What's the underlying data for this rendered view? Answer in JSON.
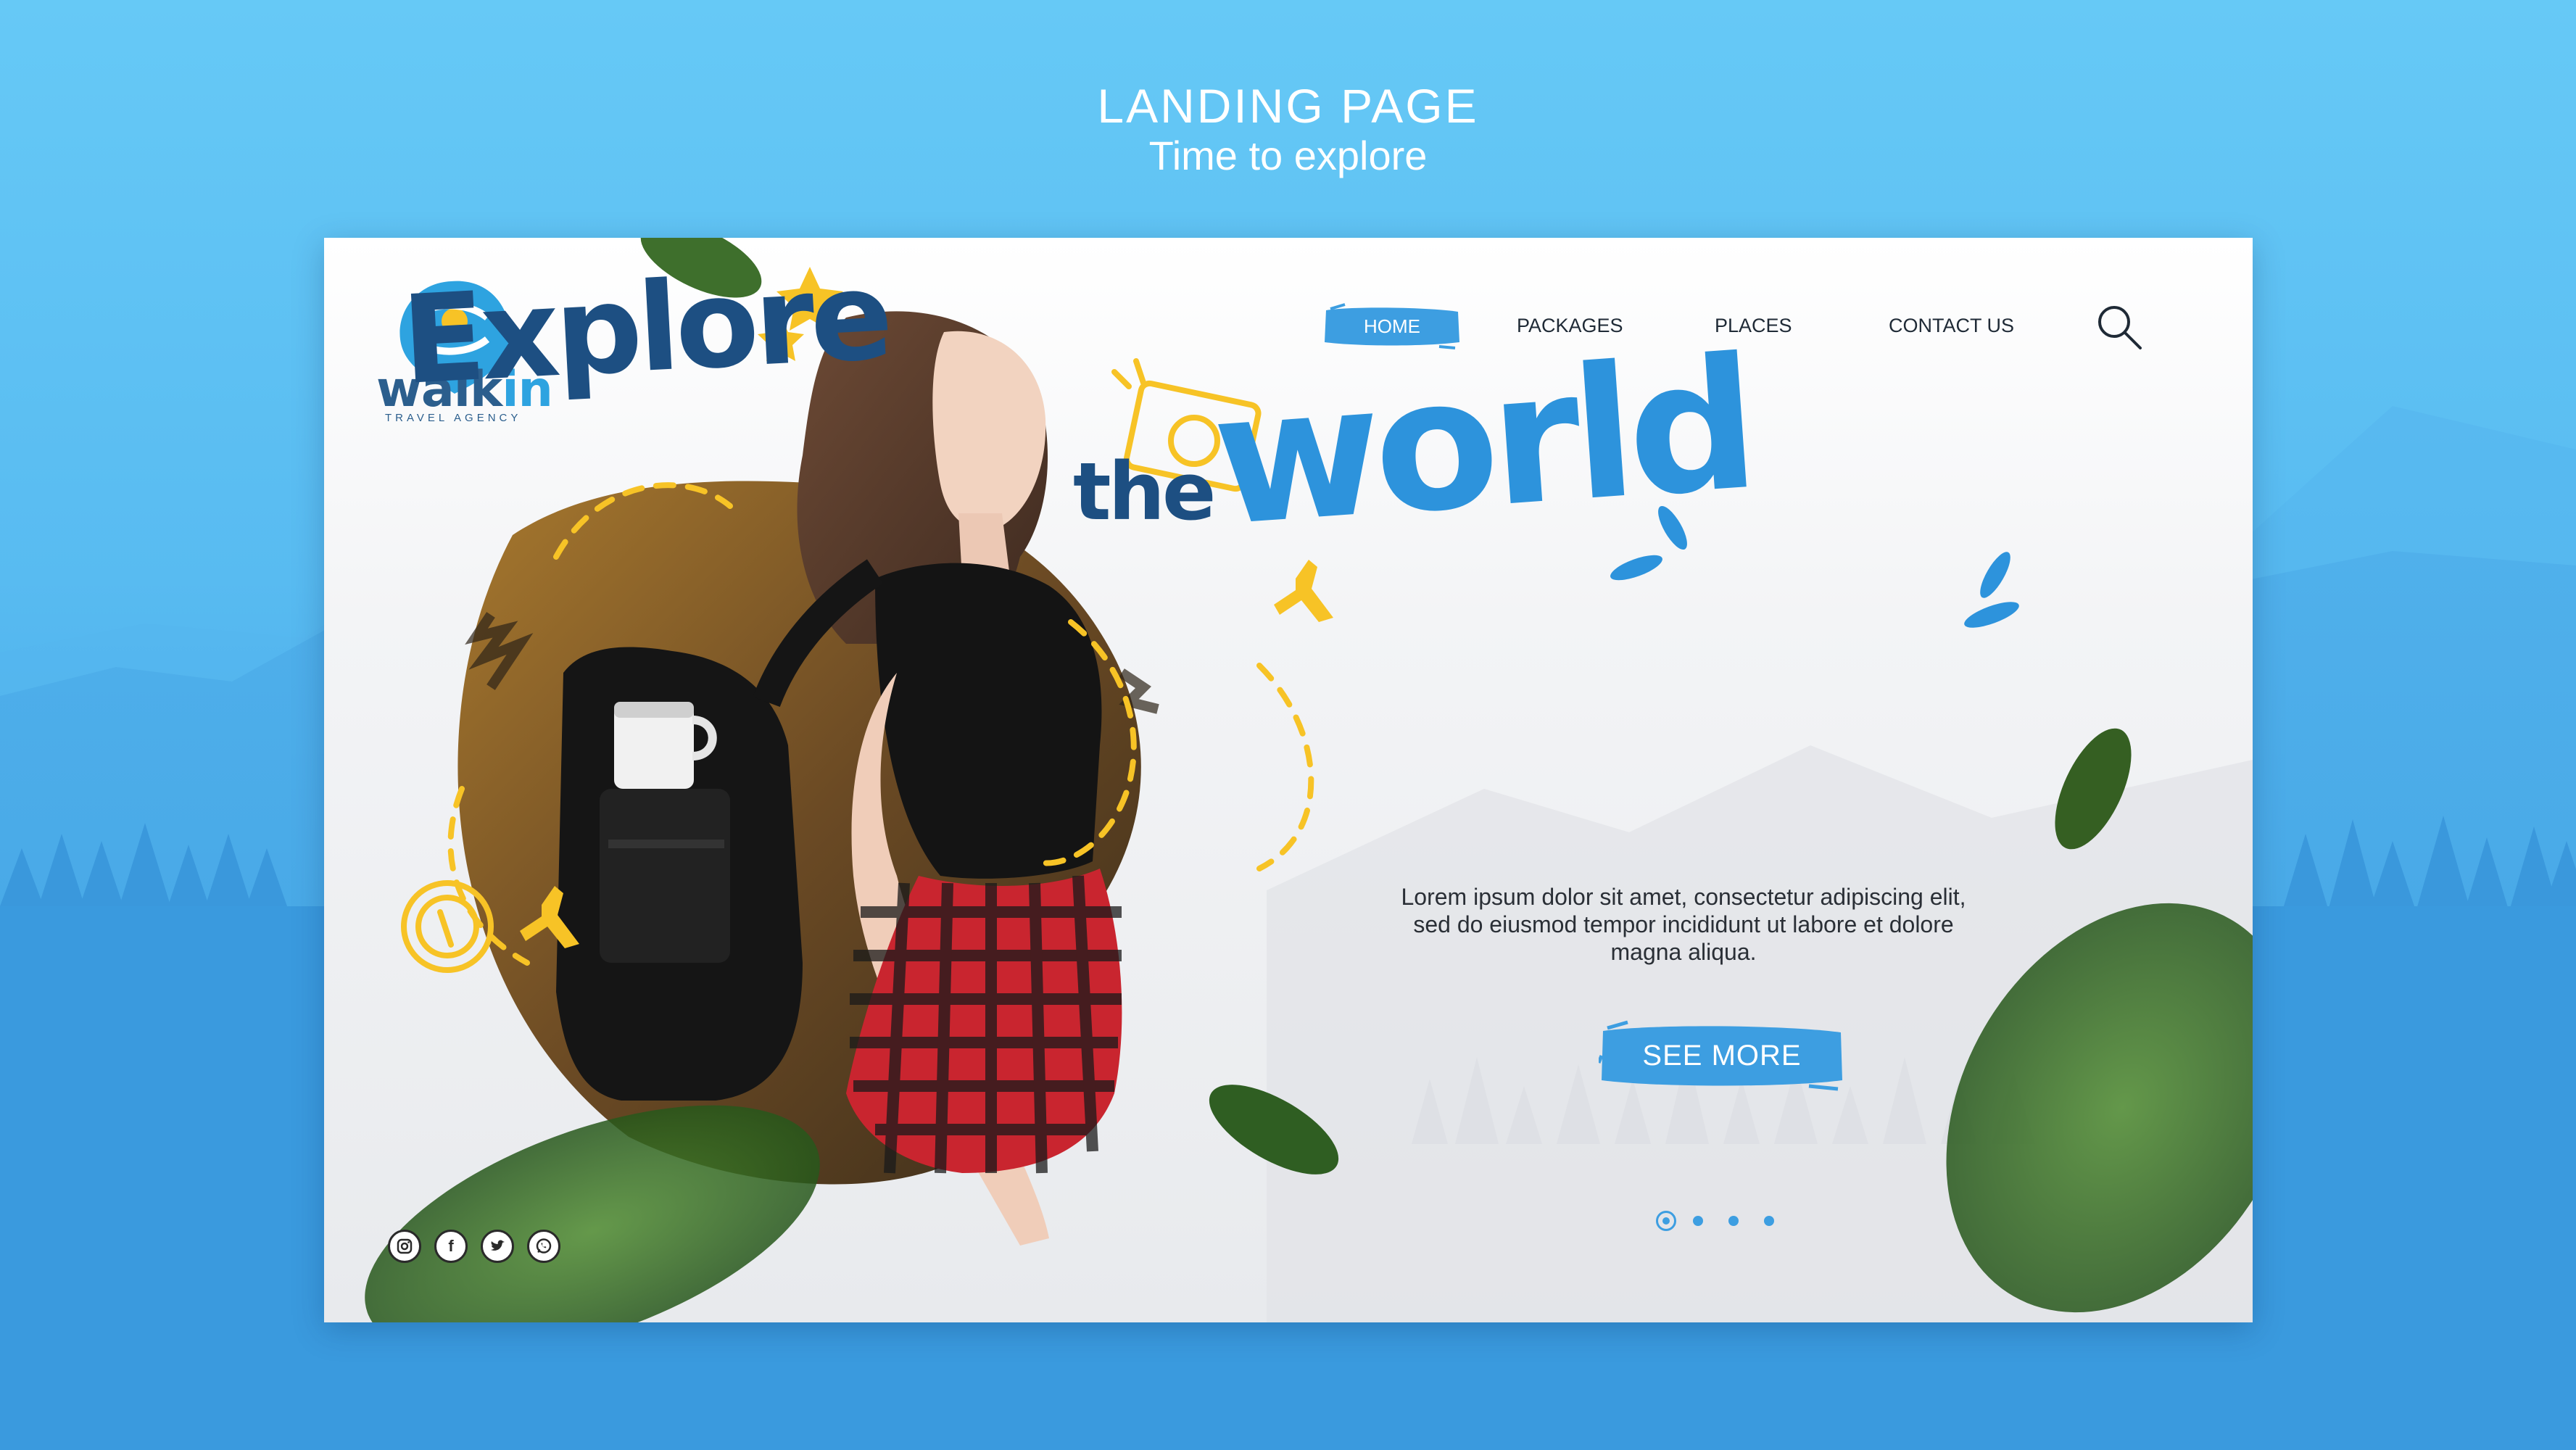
{
  "header": {
    "title": "LANDING PAGE",
    "subtitle": "Time to explore"
  },
  "brand": {
    "name_main": "walk",
    "name_accent": "in",
    "tagline": "TRAVEL AGENCY",
    "colors": {
      "primary": "#2b5e8d",
      "accent": "#2ea3e0",
      "yellow": "#f7c326"
    }
  },
  "nav": {
    "items": [
      {
        "label": "HOME",
        "active": true
      },
      {
        "label": "PACKAGES",
        "active": false
      },
      {
        "label": "PLACES",
        "active": false
      },
      {
        "label": "CONTACT US",
        "active": false
      }
    ],
    "search_icon": "search-icon"
  },
  "hero": {
    "headline_line1": "Explore",
    "headline_the": "the",
    "headline_world": "world",
    "description": "Lorem ipsum dolor sit amet, consectetur adipiscing elit, sed do eiusmod tempor incididunt ut labore et dolore magna aliqua.",
    "cta_label": "SEE MORE"
  },
  "slider": {
    "count": 4,
    "active_index": 0
  },
  "social": [
    {
      "name": "instagram-icon"
    },
    {
      "name": "facebook-icon",
      "glyph": "f"
    },
    {
      "name": "twitter-icon"
    },
    {
      "name": "whatsapp-icon"
    }
  ]
}
